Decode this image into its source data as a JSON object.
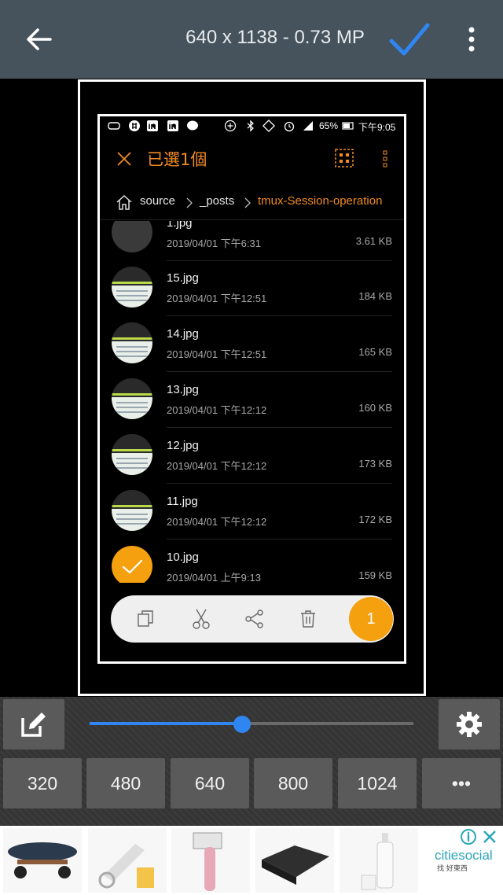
{
  "header": {
    "title": "640 x 1138 - 0.73 MP",
    "colors": {
      "bar": "#46535c",
      "accent": "#2f86f0"
    }
  },
  "phone": {
    "status": {
      "battery": "65%",
      "time": "下午9:05"
    },
    "appbar": {
      "selected_label": "已選1個"
    },
    "breadcrumb": {
      "items": [
        "source",
        "_posts",
        "tmux-Session-operation"
      ]
    },
    "files": [
      {
        "name": "1.jpg",
        "date": "2019/04/01 下午6:31",
        "size": "3.61 KB"
      },
      {
        "name": "15.jpg",
        "date": "2019/04/01 下午12:51",
        "size": "184 KB"
      },
      {
        "name": "14.jpg",
        "date": "2019/04/01 下午12:51",
        "size": "165 KB"
      },
      {
        "name": "13.jpg",
        "date": "2019/04/01 下午12:12",
        "size": "160 KB"
      },
      {
        "name": "12.jpg",
        "date": "2019/04/01 下午12:12",
        "size": "173 KB"
      },
      {
        "name": "11.jpg",
        "date": "2019/04/01 下午12:12",
        "size": "172 KB"
      },
      {
        "name": "10.jpg",
        "date": "2019/04/01 上午9:13",
        "size": "159 KB",
        "selected": true
      }
    ],
    "actions": {
      "selected_count": "1",
      "icons": [
        "copy-icon",
        "scissors-icon",
        "share-icon",
        "trash-icon"
      ]
    }
  },
  "controls": {
    "slider_fraction": 0.47,
    "presets": [
      "320",
      "480",
      "640",
      "800",
      "1024",
      "•••"
    ]
  },
  "ad": {
    "brand": "citiesocial",
    "tagline": "找 好東西"
  }
}
